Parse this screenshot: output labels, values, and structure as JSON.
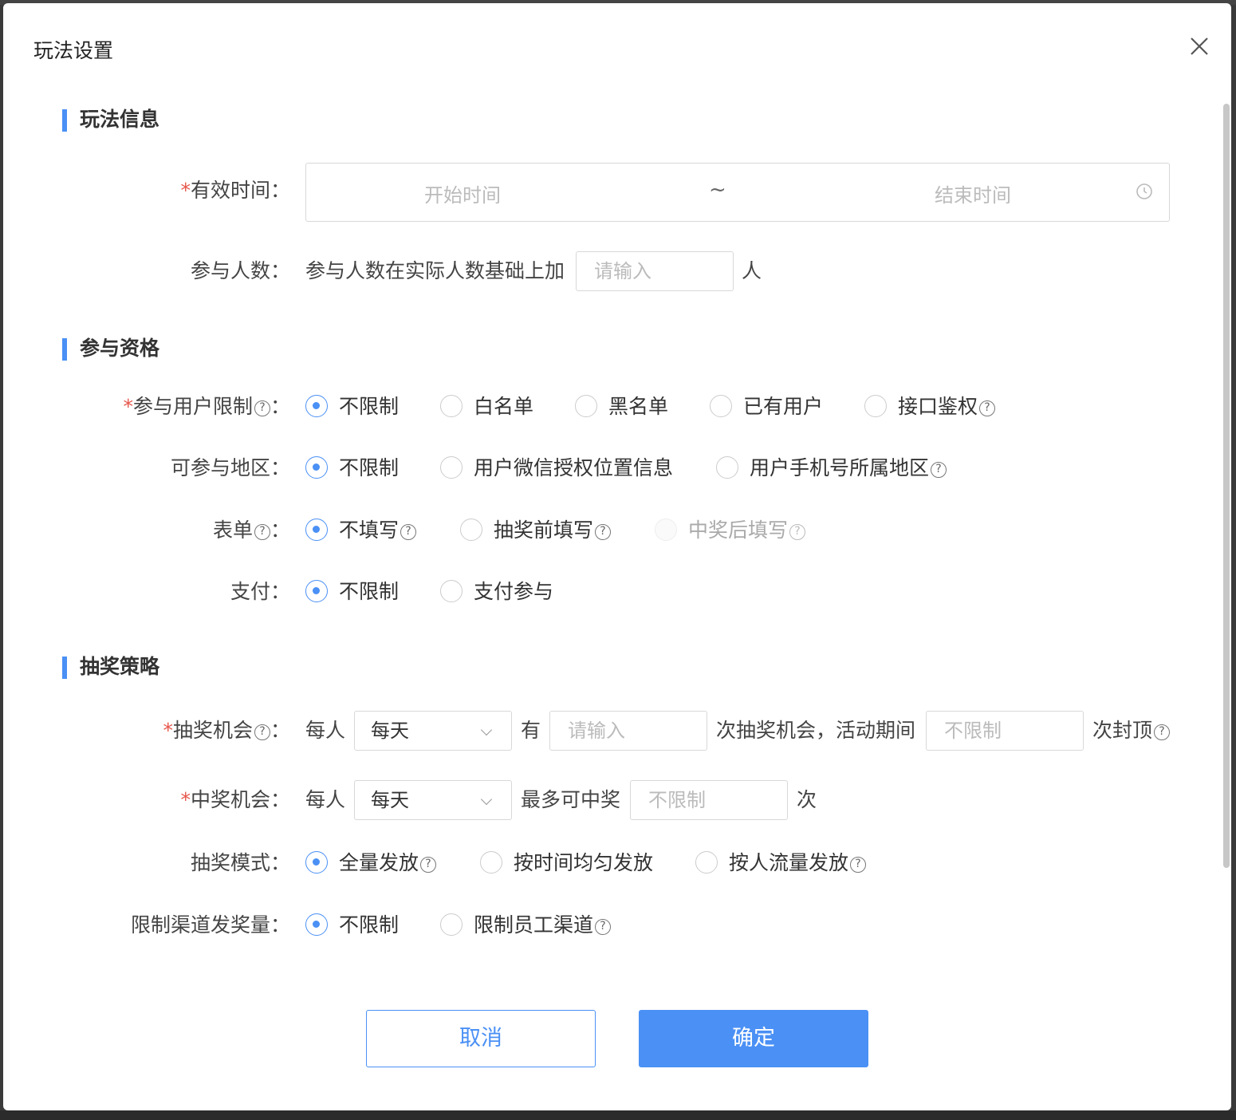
{
  "dialog": {
    "title": "玩法设置",
    "cancel_label": "取消",
    "confirm_label": "确定"
  },
  "sections": {
    "info": "玩法信息",
    "qualification": "参与资格",
    "strategy": "抽奖策略"
  },
  "valid_time": {
    "label": "有效时间：",
    "start_placeholder": "开始时间",
    "separator": "~",
    "end_placeholder": "结束时间"
  },
  "participants": {
    "label": "参与人数：",
    "prefix": "参与人数在实际人数基础上加",
    "placeholder": "请输入",
    "suffix": "人"
  },
  "user_limit": {
    "label": "参与用户限制",
    "colon": "：",
    "options": [
      "不限制",
      "白名单",
      "黑名单",
      "已有用户",
      "接口鉴权"
    ],
    "selected": "不限制"
  },
  "region": {
    "label": "可参与地区：",
    "options": [
      "不限制",
      "用户微信授权位置信息",
      "用户手机号所属地区"
    ],
    "selected": "不限制"
  },
  "form": {
    "label": "表单",
    "colon": "：",
    "options": [
      "不填写",
      "抽奖前填写",
      "中奖后填写"
    ],
    "selected": "不填写"
  },
  "payment": {
    "label": "支付：",
    "options": [
      "不限制",
      "支付参与"
    ],
    "selected": "不限制"
  },
  "draw_chance": {
    "label": "抽奖机会",
    "colon": "：",
    "per_person": "每人",
    "period": "每天",
    "has": "有",
    "count_placeholder": "请输入",
    "middle": "次抽奖机会，活动期间",
    "cap_placeholder": "不限制",
    "suffix": "次封顶"
  },
  "win_chance": {
    "label": "中奖机会：",
    "per_person": "每人",
    "period": "每天",
    "middle": "最多可中奖",
    "placeholder": "不限制",
    "suffix": "次"
  },
  "draw_mode": {
    "label": "抽奖模式：",
    "options": [
      "全量发放",
      "按时间均匀发放",
      "按人流量发放"
    ],
    "selected": "全量发放"
  },
  "channel_limit": {
    "label": "限制渠道发奖量：",
    "options": [
      "不限制",
      "限制员工渠道"
    ],
    "selected": "不限制"
  },
  "required_mark": "*",
  "help_glyph": "?",
  "colors": {
    "accent": "#4a90f5",
    "required": "#e6574b"
  }
}
